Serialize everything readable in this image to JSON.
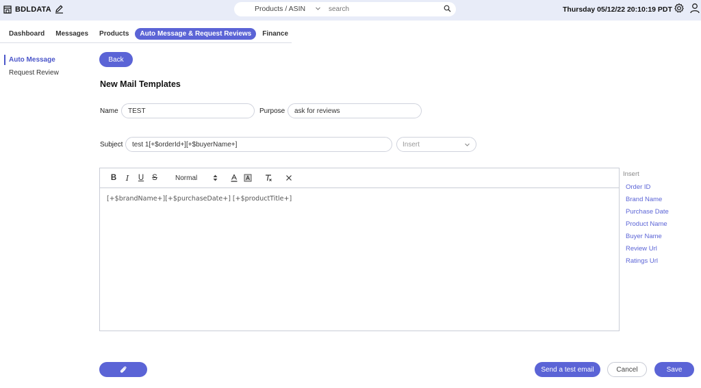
{
  "header": {
    "brand": "BDLDATA",
    "search_scope": "Products / ASIN",
    "search_placeholder": "search",
    "datetime": "Thursday 05/12/22 20:10:19 PDT"
  },
  "tabs": [
    {
      "label": "Dashboard",
      "active": false
    },
    {
      "label": "Messages",
      "active": false
    },
    {
      "label": "Products",
      "active": false
    },
    {
      "label": "Auto Message & Request Reviews",
      "active": true
    },
    {
      "label": "Finance",
      "active": false
    }
  ],
  "side_nav": [
    {
      "label": "Auto Message",
      "active": true
    },
    {
      "label": "Request Review",
      "active": false
    }
  ],
  "back_label": "Back",
  "page_title": "New Mail Templates",
  "form": {
    "name_label": "Name",
    "name_value": "TEST",
    "purpose_label": "Purpose",
    "purpose_value": "ask for reviews",
    "subject_label": "Subject",
    "subject_value": "test 1[+$orderId+][+$buyerName+]",
    "insert_placeholder": "Insert"
  },
  "editor": {
    "format_select": "Normal",
    "body": "[+$brandName+][+$purchaseDate+] [+$productTitle+]"
  },
  "insert_panel": {
    "title": "Insert",
    "items": [
      "Order ID",
      "Brand Name",
      "Purchase Date",
      "Product Name",
      "Buyer Name",
      "Review Url",
      "Ratings Url"
    ]
  },
  "footer": {
    "send_test_label": "Send a test email",
    "cancel_label": "Cancel",
    "save_label": "Save"
  },
  "colors": {
    "accent": "#5b64d6",
    "topbar_bg": "#e8ecf8"
  }
}
